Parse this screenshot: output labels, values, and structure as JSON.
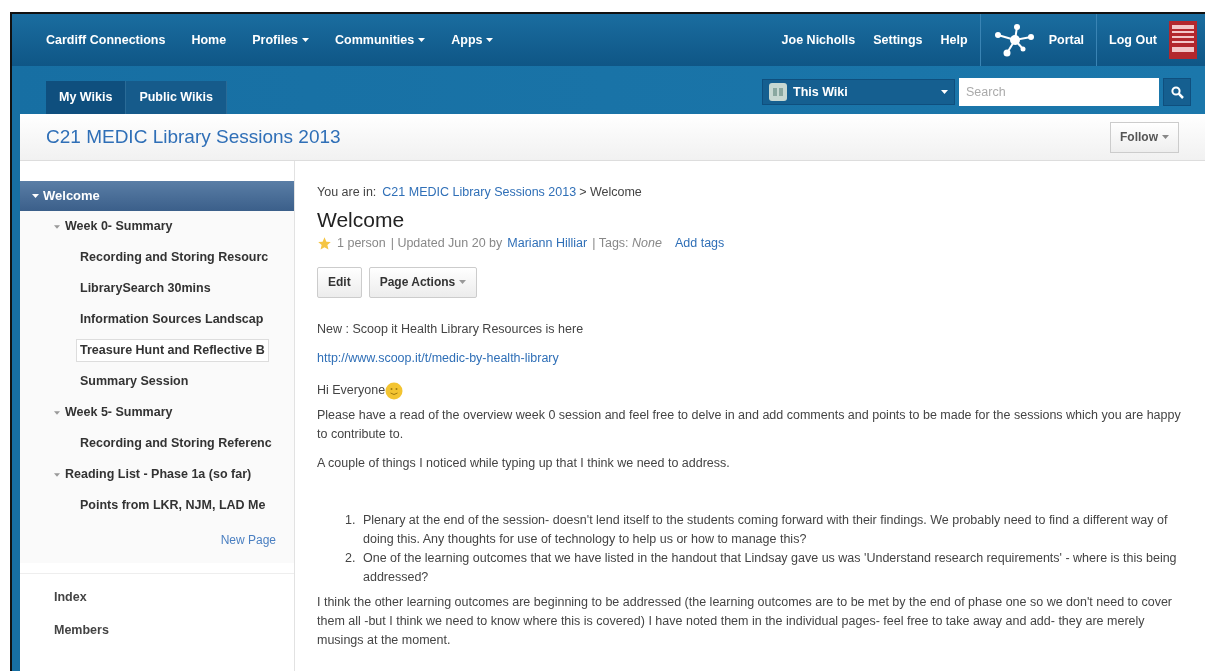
{
  "top_nav": {
    "items": [
      {
        "label": "Cardiff Connections",
        "dropdown": false
      },
      {
        "label": "Home",
        "dropdown": false
      },
      {
        "label": "Profiles",
        "dropdown": true
      },
      {
        "label": "Communities",
        "dropdown": true
      },
      {
        "label": "Apps",
        "dropdown": true
      }
    ],
    "right_items": [
      "Joe Nicholls",
      "Settings",
      "Help"
    ],
    "portal": "Portal",
    "logout": "Log Out"
  },
  "sub_nav": {
    "tabs": [
      {
        "label": "My Wikis",
        "selected": true
      },
      {
        "label": "Public Wikis",
        "selected": false
      }
    ],
    "scope": "This Wiki",
    "search": {
      "placeholder": "Search"
    }
  },
  "wiki_title": "C21 MEDIC Library Sessions 2013",
  "follow": "Follow",
  "sidebar": {
    "tree": [
      {
        "label": "Welcome",
        "selected": true,
        "expanded": true,
        "children": [
          {
            "label": "Week 0- Summary",
            "expanded": true,
            "selected": false,
            "children": [
              {
                "label": "Recording and Storing Resourc",
                "selected": false
              },
              {
                "label": "LibrarySearch 30mins",
                "selected": false
              },
              {
                "label": "Information Sources Landscap",
                "selected": false
              },
              {
                "label": "Treasure Hunt and Reflective B",
                "selected": false,
                "focused": true
              },
              {
                "label": "Summary Session",
                "selected": false
              }
            ]
          },
          {
            "label": "Week 5- Summary",
            "expanded": true,
            "selected": false,
            "children": [
              {
                "label": "Recording and Storing Referenc",
                "selected": false
              }
            ]
          },
          {
            "label": "Reading List - Phase 1a (so far)",
            "expanded": true,
            "selected": false,
            "children": [
              {
                "label": "Points from LKR, NJM, LAD Me",
                "selected": false
              }
            ]
          }
        ]
      }
    ],
    "new_page": "New Page",
    "links": [
      "Index",
      "Members"
    ]
  },
  "breadcrumb": {
    "prefix": "You are in:",
    "link": "C21 MEDIC Library Sessions 2013",
    "current": "> Welcome"
  },
  "page": {
    "title": "Welcome",
    "likes": "1 person",
    "updated": "| Updated Jun 20 by",
    "author": "Mariann Hilliar",
    "tags": "| Tags: *None*",
    "add_tags": "Add tags",
    "buttons": [
      {
        "label": "Edit",
        "dropdown": false
      },
      {
        "label": "Page Actions",
        "dropdown": true
      }
    ],
    "body": [
      {
        "kind": "text",
        "text": "New : Scoop it Health Library Resources is here"
      },
      {
        "kind": "link",
        "text": "http://www.scoop.it/t/medic-by-health-library"
      },
      {
        "kind": "greeting",
        "text": "Hi Everyone"
      },
      {
        "kind": "text",
        "text": "Please have a read of the overview week 0 session and feel free to delve in and add comments and points to be made for the sessions which you are happy to contribute to."
      },
      {
        "kind": "text",
        "text": "A couple of things I noticed while typing up that I think we need to address."
      },
      {
        "kind": "list",
        "items": [
          {
            "number": "1.",
            "text": "Plenary at the end of the session- doesn't lend itself to the students coming forward with their findings. We probably need to find a different way of doing this. Any thoughts for use of technology to help us or how to manage this?"
          },
          {
            "number": "2.",
            "text": "One of the learning outcomes that we have listed in the handout that Lindsay gave us was 'Understand research requirements' - where is this being addressed?"
          }
        ]
      },
      {
        "kind": "text",
        "text": "I think the other learning outcomes are beginning to be addressed (the learning outcomes are to be met by the end of phase one so we don't need to cover them all -but I think we need to know where this is covered)  I have noted them in the individual pages- feel free to take away and add- they are merely musings at the moment."
      }
    ]
  }
}
